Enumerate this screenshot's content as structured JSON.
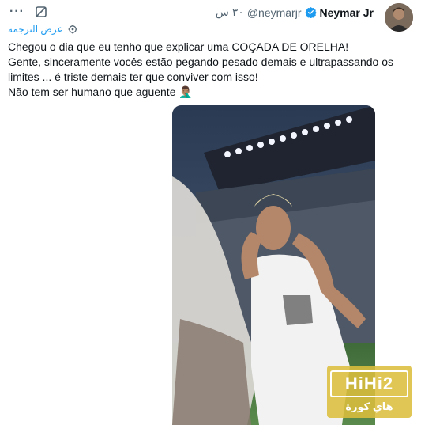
{
  "header": {
    "name": "Neymar Jr",
    "handle": "@neymarjr",
    "time": "٣٠ س",
    "more_label": "···",
    "icons": {
      "more": "more-dots-icon",
      "grok": "grok-icon",
      "verified": "verified-badge-icon",
      "translate": "translate-gear-icon"
    }
  },
  "translate": {
    "label": "عرض الترجمة"
  },
  "tweet": {
    "lines": [
      "Chegou o dia que eu tenho que explicar uma COÇADA DE ORELHA!",
      "Gente, sinceramente vocês estão pegando pesado demais e ultrapassando os",
      "limites ... é triste demais ter que conviver com isso!",
      "Não tem ser humano que aguente 🤦🏽‍♂️"
    ]
  },
  "watermark": {
    "logo": "HiHi2",
    "subtitle": "هاي كورة"
  },
  "colors": {
    "link": "#1d9bf0",
    "verified": "#1d9bf0",
    "secondary_text": "#536471",
    "watermark": "#dcbe3c"
  }
}
